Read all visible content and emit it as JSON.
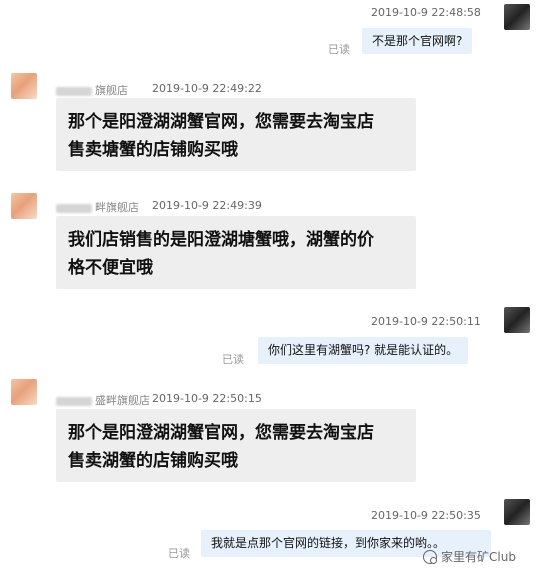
{
  "messages": [
    {
      "side": "out",
      "time": "2019-10-9 22:48:58",
      "text": "不是那个官网啊?",
      "status": "已读"
    },
    {
      "side": "in",
      "shop": "旗舰店",
      "time": "2019-10-9 22:49:22",
      "lines": [
        "那个是阳澄湖湖蟹官网，您需要去淘宝店",
        "售卖塘蟹的店铺购买哦"
      ]
    },
    {
      "side": "in",
      "shop": "畔旗舰店",
      "time": "2019-10-9 22:49:39",
      "lines": [
        "我们店销售的是阳澄湖塘蟹哦，湖蟹的价",
        "格不便宜哦"
      ]
    },
    {
      "side": "out",
      "time": "2019-10-9 22:50:11",
      "text": "你们这里有湖蟹吗? 就是能认证的。",
      "status": "已读"
    },
    {
      "side": "in",
      "shop": "盛畔旗舰店",
      "time": "2019-10-9 22:50:15",
      "lines": [
        "那个是阳澄湖湖蟹官网，您需要去淘宝店",
        "售卖湖蟹的店铺购买哦"
      ]
    },
    {
      "side": "out",
      "time": "2019-10-9 22:50:35",
      "text": "我就是点那个官网的链接，到你家来的哟。。",
      "status": "已读"
    }
  ],
  "watermark": "家里有矿Club",
  "colors": {
    "bubble_in": "#eeeeee",
    "bubble_out": "#e6f1fc"
  }
}
